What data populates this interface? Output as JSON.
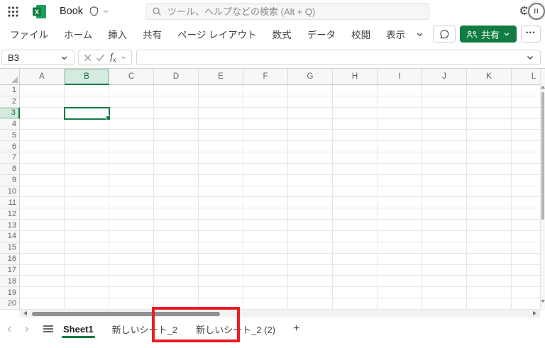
{
  "top_bar": {
    "app_title": "Book",
    "search_placeholder": "ツール、ヘルプなどの検索 (Alt + Q)",
    "avatar_label": "II",
    "gear_glyph": "⚙"
  },
  "menu_bar": {
    "tabs": [
      "ファイル",
      "ホーム",
      "挿入",
      "共有",
      "ページ レイアウト",
      "数式",
      "データ",
      "校閲",
      "表示"
    ],
    "share_label": "共有",
    "more_label": "•••"
  },
  "formula_bar": {
    "name_box_value": "B3",
    "fx_label": "fx",
    "formula_value": ""
  },
  "grid": {
    "selected_cell": "B3",
    "selected_column": "B",
    "selected_row": "3",
    "columns": [
      "A",
      "B",
      "C",
      "D",
      "E",
      "F",
      "G",
      "H",
      "I",
      "J",
      "K",
      "L"
    ],
    "rows": [
      "1",
      "2",
      "3",
      "4",
      "5",
      "6",
      "7",
      "8",
      "9",
      "10",
      "11",
      "12",
      "13",
      "14",
      "15",
      "16",
      "17",
      "18",
      "19",
      "20"
    ]
  },
  "sheet_bar": {
    "tabs": [
      {
        "label": "Sheet1",
        "active": true,
        "annotated": false
      },
      {
        "label": "新しいシート_2",
        "active": false,
        "annotated": false
      },
      {
        "label": "新しいシート_2 (2)",
        "active": false,
        "annotated": true
      }
    ],
    "add_sheet_label": "+"
  },
  "annotation": {
    "highlighted_tab": "新しいシート_2 (2)",
    "color": "#EC1C24"
  },
  "colors": {
    "accent_green": "#107C41",
    "selection_bg": "#D6EBDF",
    "annotation_red": "#EC1C24"
  }
}
